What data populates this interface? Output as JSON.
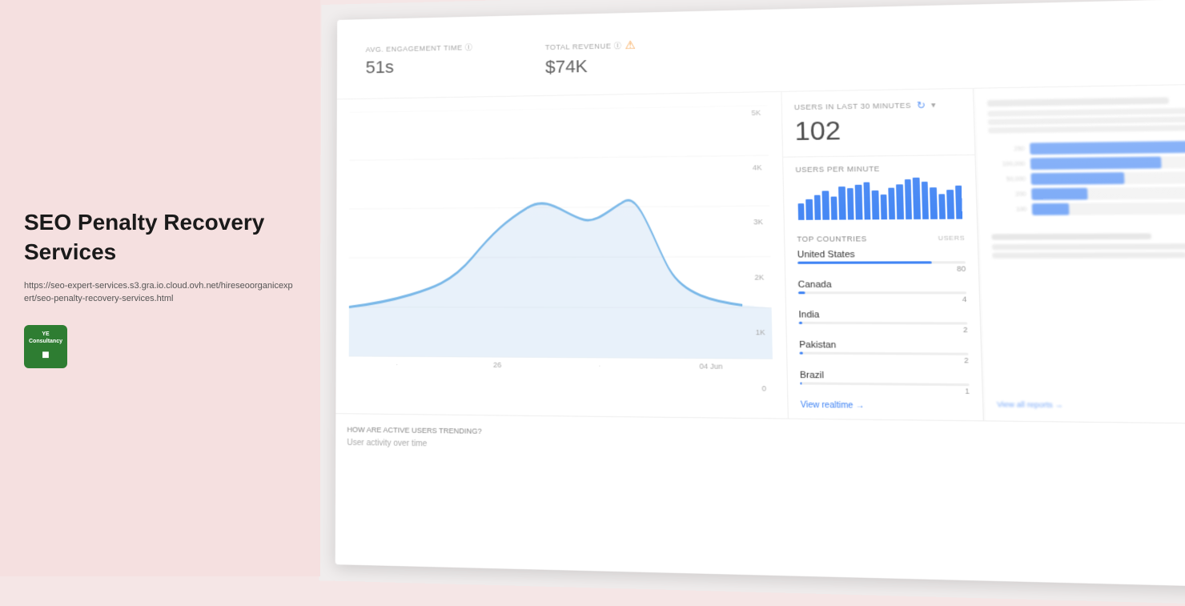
{
  "left": {
    "title": "SEO Penalty Recovery Services",
    "url": "https://seo-expert-services.s3.gra.io.cloud.ovh.net/hireseoorganicexpert/seo-penalty-recovery-services.html",
    "logo_line1": "YE Consultancy",
    "logo_icon": "■"
  },
  "dashboard": {
    "metrics": [
      {
        "label": "Avg. engagement time ⓘ",
        "value": "51s"
      },
      {
        "label": "Total revenue ⓘ",
        "value": "$74K",
        "warning": true
      }
    ],
    "chart": {
      "y_labels": [
        "5K",
        "4K",
        "3K",
        "2K",
        "1K",
        "0"
      ],
      "x_labels": [
        "",
        "26",
        "",
        "04 Jun"
      ]
    },
    "users_panel": {
      "header": "USERS IN LAST 30 MINUTES",
      "count": "102",
      "per_minute_label": "USERS PER MINUTE",
      "bar_heights": [
        20,
        25,
        30,
        35,
        28,
        40,
        38,
        42,
        45,
        35,
        30,
        38,
        42,
        48,
        50,
        45,
        38,
        30,
        35,
        40
      ],
      "top_countries_label": "TOP COUNTRIES",
      "users_col": "USERS",
      "countries": [
        {
          "name": "United States",
          "users": "80",
          "bar_pct": 80
        },
        {
          "name": "Canada",
          "users": "4",
          "bar_pct": 4
        },
        {
          "name": "India",
          "users": "2",
          "bar_pct": 2
        },
        {
          "name": "Pakistan",
          "users": "2",
          "bar_pct": 2
        },
        {
          "name": "Brazil",
          "users": "1",
          "bar_pct": 1
        }
      ],
      "view_realtime": "View realtime →"
    },
    "right_panel": {
      "title": "The insights all types tell you",
      "bars": [
        {
          "label": "250",
          "pct": 90
        },
        {
          "label": "100,000",
          "pct": 70
        },
        {
          "label": "50,000",
          "pct": 50
        },
        {
          "label": "200",
          "pct": 30
        },
        {
          "label": "100",
          "pct": 20
        }
      ]
    },
    "bottom": {
      "title": "HOW ARE ACTIVE USERS TRENDING?",
      "subtitle": "User activity over time"
    }
  }
}
